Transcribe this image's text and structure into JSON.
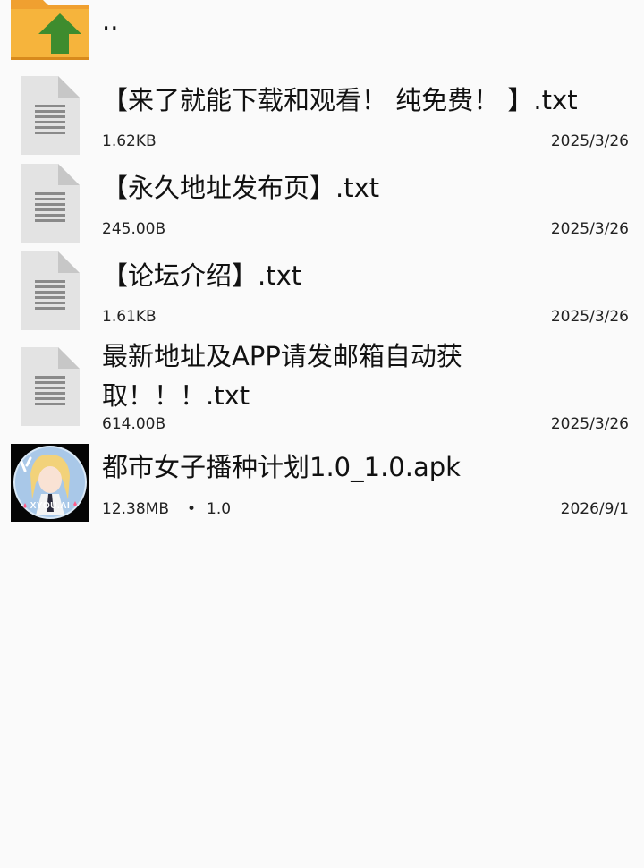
{
  "parent_entry": {
    "label": "..",
    "icon": "folder-up-icon"
  },
  "files": [
    {
      "name": "【来了就能下载和观看！ 纯免费！ 】.txt",
      "size": "1.62KB",
      "date": "2025/3/26",
      "icon": "text-file-icon"
    },
    {
      "name": "【永久地址发布页】.txt",
      "size": "245.00B",
      "date": "2025/3/26",
      "icon": "text-file-icon"
    },
    {
      "name": "【论坛介绍】.txt",
      "size": "1.61KB",
      "date": "2025/3/26",
      "icon": "text-file-icon"
    },
    {
      "name": "最新地址及APP请发邮箱自动获取！！！.txt",
      "size": "614.00B",
      "date": "2025/3/26",
      "icon": "text-file-icon"
    },
    {
      "name": "都市女子播种计划1.0_1.0.apk",
      "size": "12.38MB",
      "separator": "•",
      "version": "1.0",
      "date": "2026/9/1",
      "icon": "app-icon",
      "icon_label": "XYOU.AI"
    }
  ]
}
